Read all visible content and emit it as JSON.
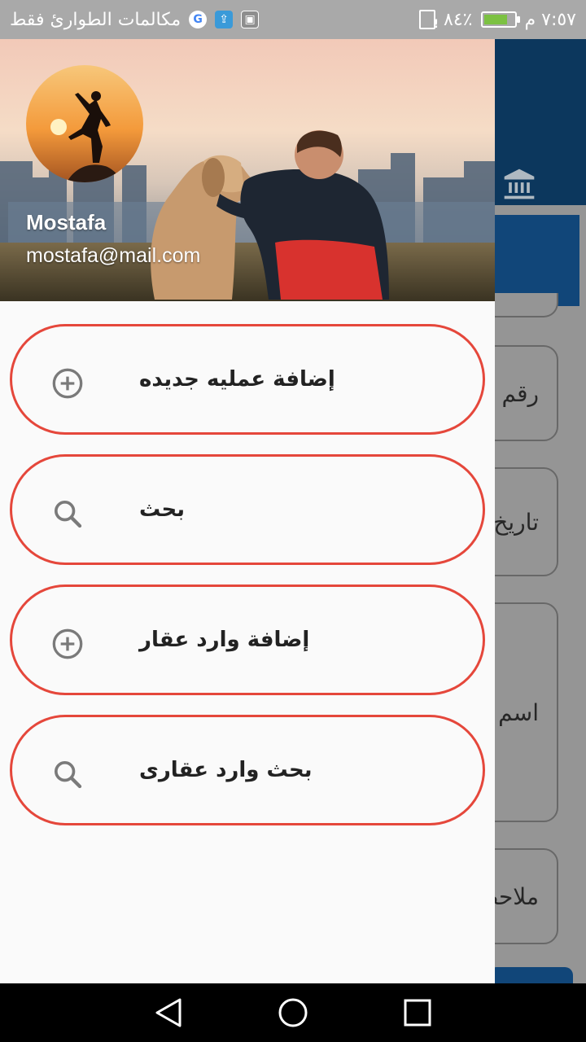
{
  "status_bar": {
    "carrier_text": "مكالمات الطوارئ فقط",
    "time": "٧:٥٧ م",
    "battery": "٨٤٪",
    "battery_level": 0.84,
    "icons": [
      "google-icon",
      "usb-icon",
      "image-icon",
      "sim-alert-icon",
      "battery-charging-icon"
    ]
  },
  "drawer": {
    "user_name": "Mostafa",
    "user_email": "mostafa@mail.com",
    "items": [
      {
        "label": "إضافة عمليه جديده",
        "icon": "add-circle-icon"
      },
      {
        "label": "بحث",
        "icon": "search-icon"
      },
      {
        "label": "إضافة وارد عقار",
        "icon": "add-circle-icon"
      },
      {
        "label": "بحث وارد عقارى",
        "icon": "search-icon"
      }
    ]
  },
  "background_app": {
    "fields": [
      "رقم ا",
      "تاريخ",
      "اسم",
      "ملاحظ"
    ],
    "appbar_icon": "bank-icon"
  },
  "colors": {
    "drawer_item_border": "#e5473b",
    "appbar": "#0d3a63",
    "drawer_bg": "#fafafa"
  },
  "navigation": {
    "buttons": [
      "back-icon",
      "home-icon",
      "recents-icon"
    ]
  }
}
